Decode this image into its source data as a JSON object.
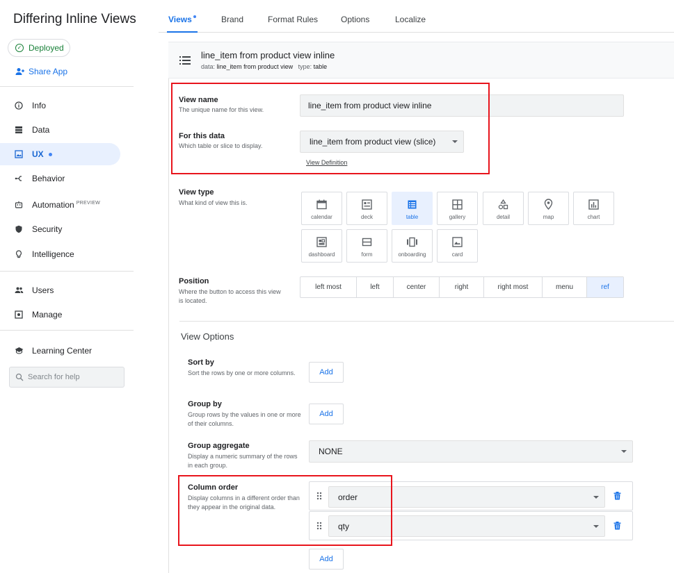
{
  "app": {
    "title": "Differing Inline Views",
    "status": "Deployed",
    "share_label": "Share App"
  },
  "sidebar": {
    "items": [
      {
        "label": "Info",
        "icon": "info-icon"
      },
      {
        "label": "Data",
        "icon": "database-icon"
      },
      {
        "label": "UX",
        "icon": "image-icon",
        "active": true
      },
      {
        "label": "Behavior",
        "icon": "workflow-icon"
      },
      {
        "label": "Automation",
        "icon": "robot-icon",
        "badge": "PREVIEW"
      },
      {
        "label": "Security",
        "icon": "shield-icon"
      },
      {
        "label": "Intelligence",
        "icon": "lightbulb-icon"
      },
      {
        "label": "Users",
        "icon": "people-icon"
      },
      {
        "label": "Manage",
        "icon": "settings-box-icon"
      },
      {
        "label": "Learning Center",
        "icon": "graduation-cap-icon"
      }
    ],
    "search_placeholder": "Search for help"
  },
  "tabs": [
    {
      "label": "Views",
      "active": true
    },
    {
      "label": "Brand"
    },
    {
      "label": "Format Rules"
    },
    {
      "label": "Options"
    },
    {
      "label": "Localize"
    }
  ],
  "view": {
    "title": "line_item from product view inline",
    "data_label": "data:",
    "data_value": "line_item from product view",
    "type_label": "type:",
    "type_value": "table"
  },
  "form": {
    "view_name": {
      "label": "View name",
      "desc": "The unique name for this view.",
      "value": "line_item from product view inline"
    },
    "for_data": {
      "label": "For this data",
      "desc": "Which table or slice to display.",
      "value": "line_item from product view (slice)",
      "link": "View Definition"
    },
    "view_type": {
      "label": "View type",
      "desc": "What kind of view this is.",
      "options": [
        "calendar",
        "deck",
        "table",
        "gallery",
        "detail",
        "map",
        "chart",
        "dashboard",
        "form",
        "onboarding",
        "card"
      ],
      "selected": "table"
    },
    "position": {
      "label": "Position",
      "desc": "Where the button to access this view is located.",
      "options": [
        "left most",
        "left",
        "center",
        "right",
        "right most",
        "menu",
        "ref"
      ],
      "selected": "ref"
    }
  },
  "view_options": {
    "title": "View Options",
    "sort_by": {
      "label": "Sort by",
      "desc": "Sort the rows by one or more columns.",
      "button": "Add"
    },
    "group_by": {
      "label": "Group by",
      "desc": "Group rows by the values in one or more of their columns.",
      "button": "Add"
    },
    "group_aggregate": {
      "label": "Group aggregate",
      "desc": "Display a numeric summary of the rows in each group.",
      "value": "NONE"
    },
    "column_order": {
      "label": "Column order",
      "desc": "Display columns in a different order than they appear in the original data.",
      "columns": [
        "order",
        "qty"
      ],
      "button": "Add"
    }
  },
  "colors": {
    "accent": "#1a73e8",
    "highlight": "#e8141c",
    "deployed": "#188038"
  }
}
